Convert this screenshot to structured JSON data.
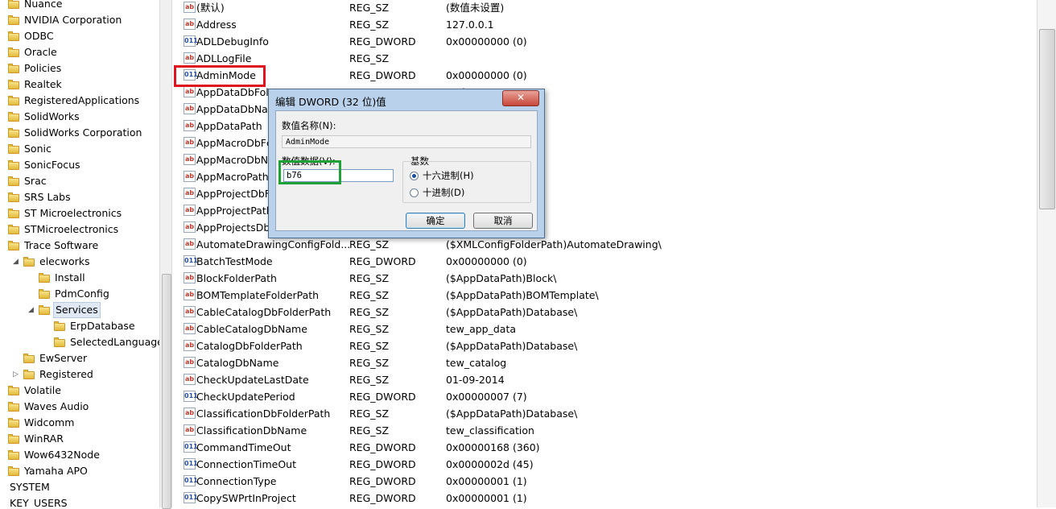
{
  "tree": {
    "nodes": [
      {
        "label": "Nuance",
        "expander": ""
      },
      {
        "label": "NVIDIA Corporation",
        "expander": ""
      },
      {
        "label": "ODBC",
        "expander": ""
      },
      {
        "label": "Oracle",
        "expander": ""
      },
      {
        "label": "Policies",
        "expander": ""
      },
      {
        "label": "Realtek",
        "expander": ""
      },
      {
        "label": "RegisteredApplications",
        "expander": ""
      },
      {
        "label": "SolidWorks",
        "expander": ""
      },
      {
        "label": "SolidWorks Corporation",
        "expander": ""
      },
      {
        "label": "Sonic",
        "expander": ""
      },
      {
        "label": "SonicFocus",
        "expander": ""
      },
      {
        "label": "Srac",
        "expander": ""
      },
      {
        "label": "SRS Labs",
        "expander": ""
      },
      {
        "label": "ST Microelectronics",
        "expander": ""
      },
      {
        "label": "STMicroelectronics",
        "expander": ""
      },
      {
        "label": "Trace Software",
        "expander": ""
      },
      {
        "label": "elecworks",
        "expander": "◢"
      },
      {
        "label": "Install",
        "expander": ""
      },
      {
        "label": "PdmConfig",
        "expander": ""
      },
      {
        "label": "Services",
        "expander": "◢"
      },
      {
        "label": "ErpDatabase",
        "expander": ""
      },
      {
        "label": "SelectedLanguage",
        "expander": ""
      },
      {
        "label": "EwServer",
        "expander": ""
      },
      {
        "label": "Registered",
        "expander": "▷"
      },
      {
        "label": "Volatile",
        "expander": ""
      },
      {
        "label": "Waves Audio",
        "expander": ""
      },
      {
        "label": "Widcomm",
        "expander": ""
      },
      {
        "label": "WinRAR",
        "expander": ""
      },
      {
        "label": "Wow6432Node",
        "expander": ""
      },
      {
        "label": "Yamaha APO",
        "expander": ""
      },
      {
        "label": "SYSTEM",
        "expander": ""
      },
      {
        "label": "KEY_USERS",
        "expander": ""
      }
    ]
  },
  "values": [
    {
      "name": "(默认)",
      "type": "REG_SZ",
      "data": "(数值未设置)",
      "icon": "ab"
    },
    {
      "name": "Address",
      "type": "REG_SZ",
      "data": "127.0.0.1",
      "icon": "ab"
    },
    {
      "name": "ADLDebugInfo",
      "type": "REG_DWORD",
      "data": "0x00000000 (0)",
      "icon": "011"
    },
    {
      "name": "ADLLogFile",
      "type": "REG_SZ",
      "data": "",
      "icon": "ab"
    },
    {
      "name": "AdminMode",
      "type": "REG_DWORD",
      "data": "0x00000000 (0)",
      "icon": "011"
    },
    {
      "name": "AppDataDbFolc",
      "type": "",
      "data": "atabase\\",
      "icon": "ab"
    },
    {
      "name": "AppDataDbNar",
      "type": "",
      "data": "",
      "icon": "ab"
    },
    {
      "name": "AppDataPath",
      "type": "",
      "data": "worksdata\\",
      "icon": "ab"
    },
    {
      "name": "AppMacroDbFc",
      "type": "",
      "data": "atabase\\",
      "icon": "ab"
    },
    {
      "name": "AppMacroDbN",
      "type": "",
      "data": "",
      "icon": "ab"
    },
    {
      "name": "AppMacroPath",
      "type": "",
      "data": "os\\",
      "icon": "ab"
    },
    {
      "name": "AppProjectDbF",
      "type": "",
      "data": "atabase\\",
      "icon": "ab"
    },
    {
      "name": "AppProjectPath",
      "type": "",
      "data": "cts\\",
      "icon": "ab"
    },
    {
      "name": "AppProjectsDbl",
      "type": "",
      "data": "",
      "icon": "ab"
    },
    {
      "name": "AutomateDrawingConfigFold...",
      "type": "REG_SZ",
      "data": "($XMLConfigFolderPath)AutomateDrawing\\",
      "icon": "ab"
    },
    {
      "name": "BatchTestMode",
      "type": "REG_DWORD",
      "data": "0x00000000 (0)",
      "icon": "011"
    },
    {
      "name": "BlockFolderPath",
      "type": "REG_SZ",
      "data": "($AppDataPath)Block\\",
      "icon": "ab"
    },
    {
      "name": "BOMTemplateFolderPath",
      "type": "REG_SZ",
      "data": "($AppDataPath)BOMTemplate\\",
      "icon": "ab"
    },
    {
      "name": "CableCatalogDbFolderPath",
      "type": "REG_SZ",
      "data": "($AppDataPath)Database\\",
      "icon": "ab"
    },
    {
      "name": "CableCatalogDbName",
      "type": "REG_SZ",
      "data": "tew_app_data",
      "icon": "ab"
    },
    {
      "name": "CatalogDbFolderPath",
      "type": "REG_SZ",
      "data": "($AppDataPath)Database\\",
      "icon": "ab"
    },
    {
      "name": "CatalogDbName",
      "type": "REG_SZ",
      "data": "tew_catalog",
      "icon": "ab"
    },
    {
      "name": "CheckUpdateLastDate",
      "type": "REG_SZ",
      "data": "01-09-2014",
      "icon": "ab"
    },
    {
      "name": "CheckUpdatePeriod",
      "type": "REG_DWORD",
      "data": "0x00000007 (7)",
      "icon": "011"
    },
    {
      "name": "ClassificationDbFolderPath",
      "type": "REG_SZ",
      "data": "($AppDataPath)Database\\",
      "icon": "ab"
    },
    {
      "name": "ClassificationDbName",
      "type": "REG_SZ",
      "data": "tew_classification",
      "icon": "ab"
    },
    {
      "name": "CommandTimeOut",
      "type": "REG_DWORD",
      "data": "0x00000168 (360)",
      "icon": "011"
    },
    {
      "name": "ConnectionTimeOut",
      "type": "REG_DWORD",
      "data": "0x0000002d (45)",
      "icon": "011"
    },
    {
      "name": "ConnectionType",
      "type": "REG_DWORD",
      "data": "0x00000001 (1)",
      "icon": "011"
    },
    {
      "name": "CopySWPrtInProject",
      "type": "REG_DWORD",
      "data": "0x00000001 (1)",
      "icon": "011"
    }
  ],
  "dialog": {
    "title": "编辑 DWORD (32 位)值",
    "close_glyph": "✕",
    "name_label": "数值名称(N):",
    "name_value": "AdminMode",
    "data_label": "数值数据(V):",
    "data_value": "b76",
    "base_label": "基数",
    "hex_label": "十六进制(H)",
    "dec_label": "十进制(D)",
    "ok_label": "确定",
    "cancel_label": "取消"
  },
  "colors": {
    "highlight_red": "#e0141e",
    "highlight_green": "#1fa038"
  }
}
